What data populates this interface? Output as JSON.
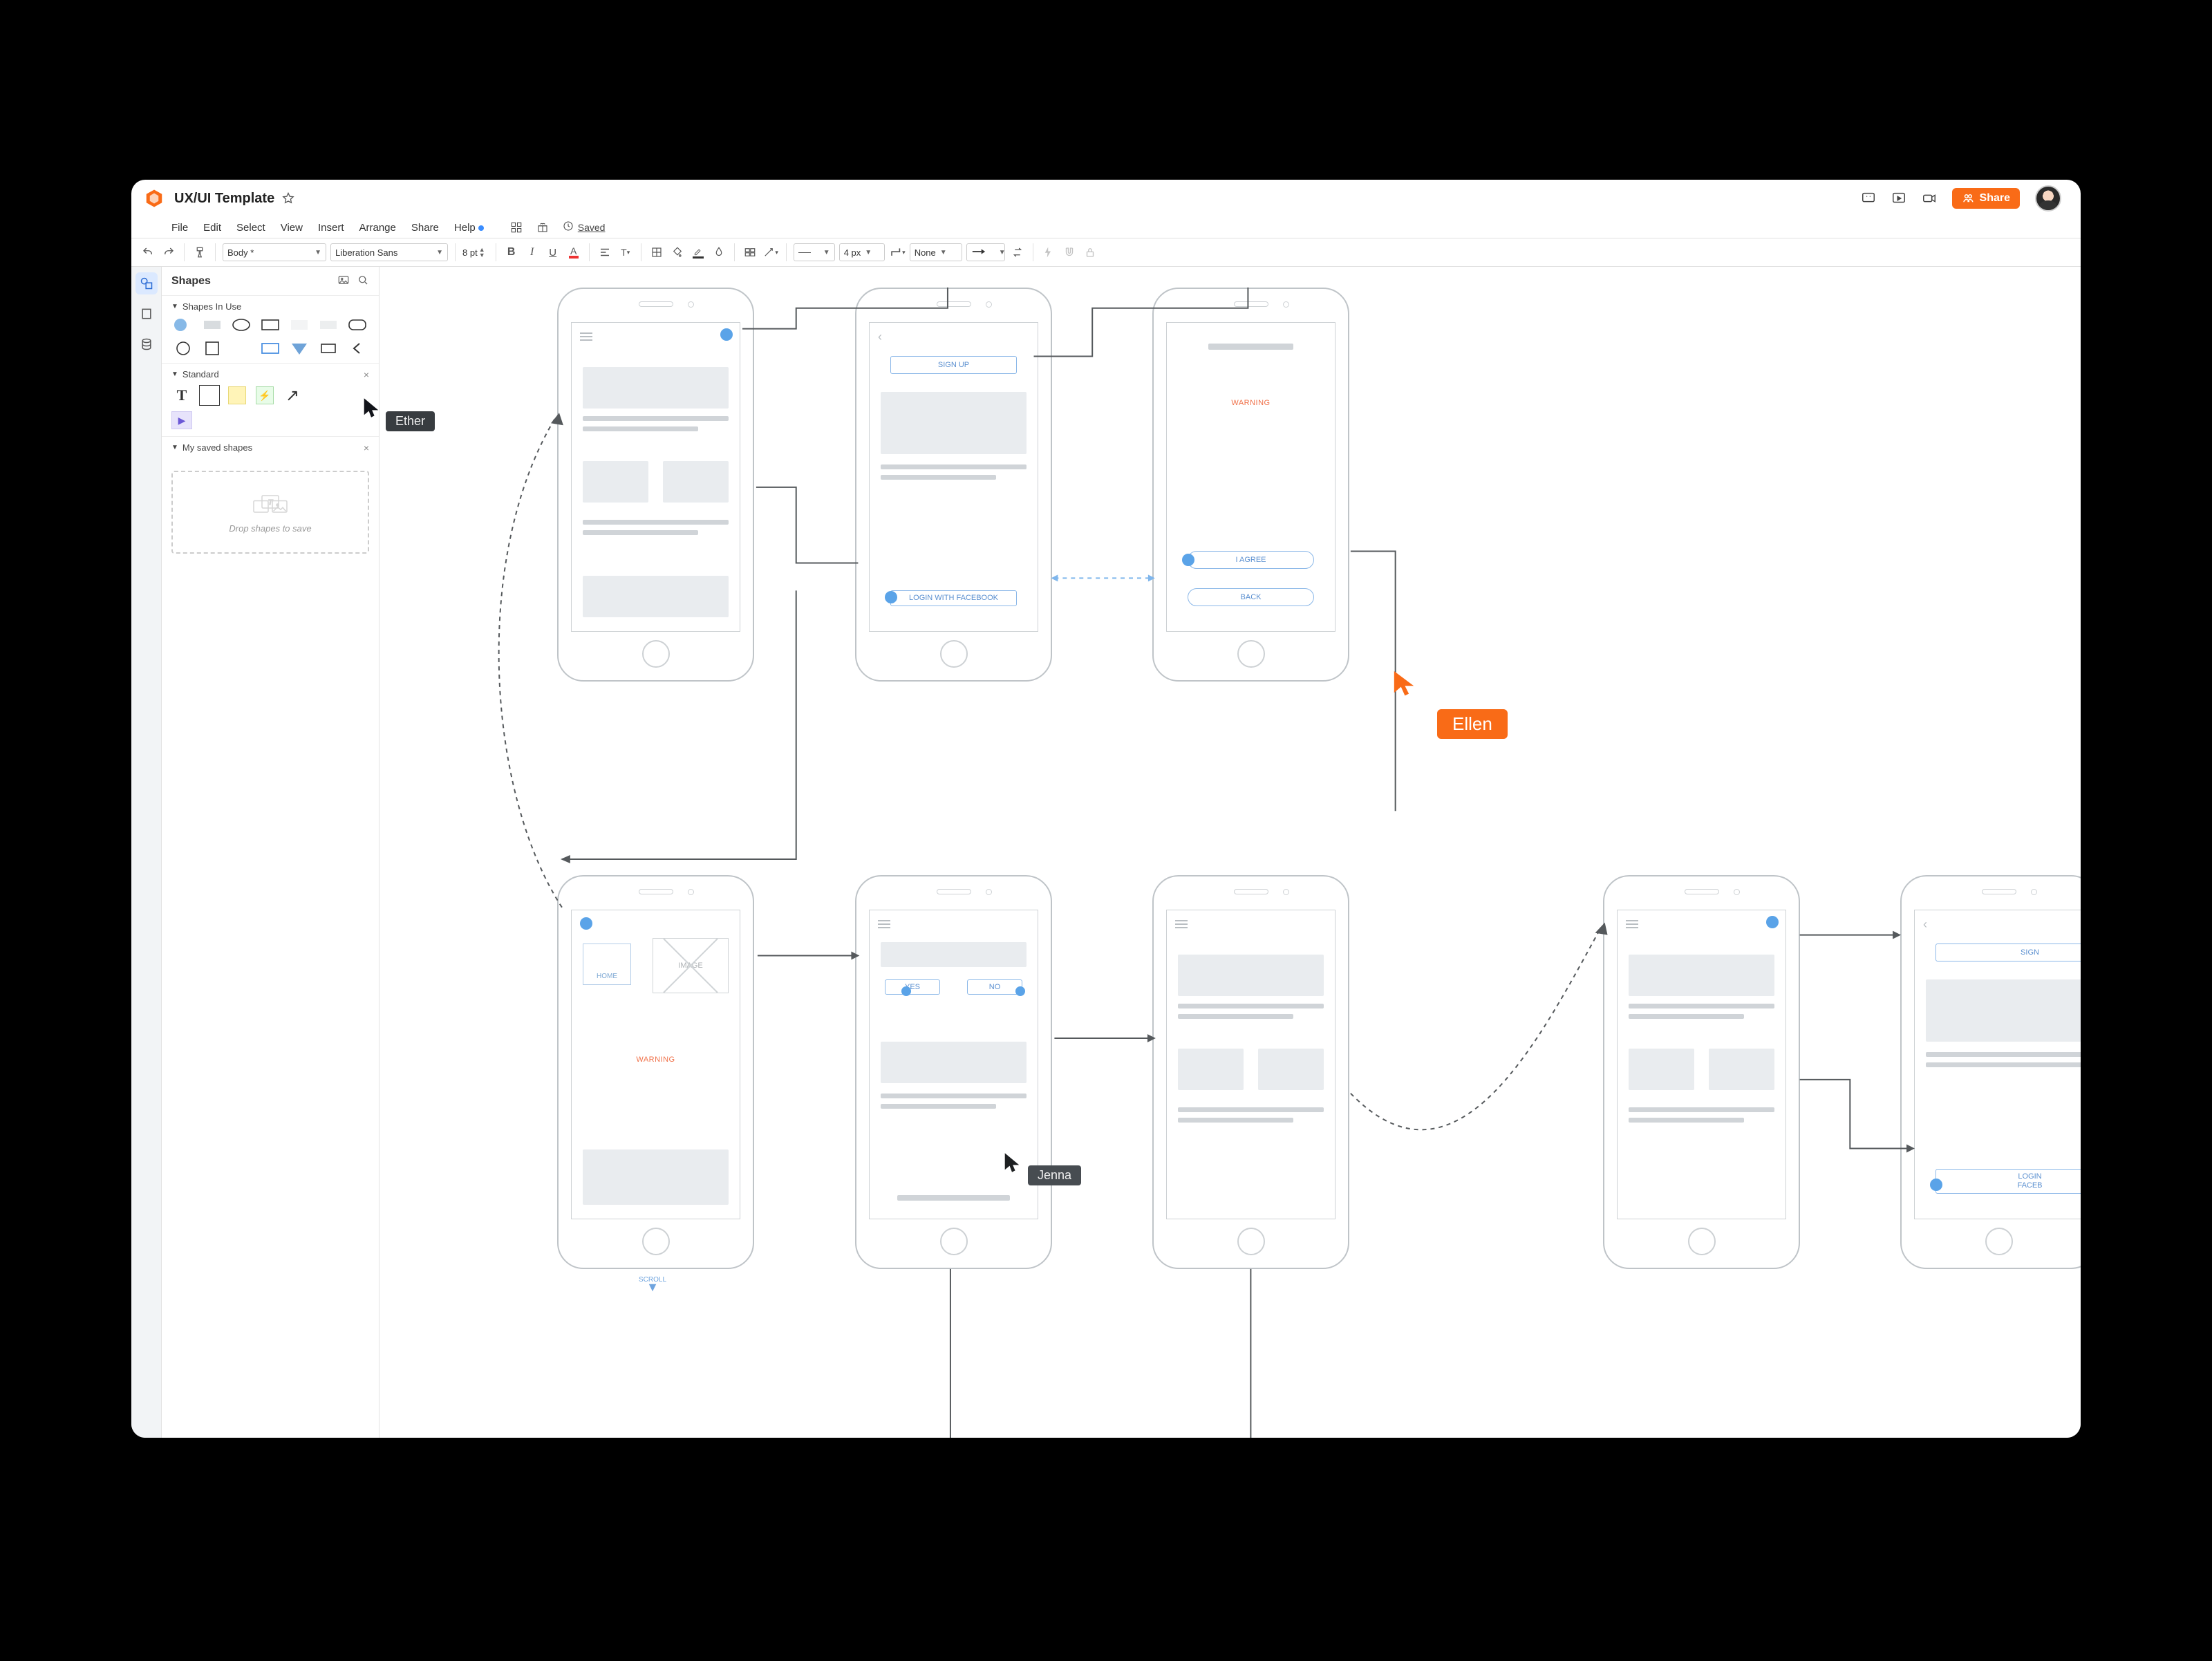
{
  "header": {
    "doc_title": "UX/UI Template",
    "share_label": "Share",
    "saved_label": "Saved"
  },
  "menu": {
    "file": "File",
    "edit": "Edit",
    "select": "Select",
    "view": "View",
    "insert": "Insert",
    "arrange": "Arrange",
    "share": "Share",
    "help": "Help"
  },
  "toolbar": {
    "style_select": "Body *",
    "font_select": "Liberation Sans",
    "font_size": "8 pt",
    "stroke_width": "4 px",
    "line_end": "None"
  },
  "sidebar": {
    "title": "Shapes",
    "section_in_use": "Shapes In Use",
    "section_standard": "Standard",
    "section_saved": "My saved shapes",
    "drop_hint": "Drop shapes to save"
  },
  "collaborators": {
    "ether": "Ether",
    "jenna": "Jenna",
    "ellen": "Ellen"
  },
  "wireframes": {
    "signup": "SIGN UP",
    "login_fb": "LOGIN WITH FACEBOOK",
    "login_fb_short": "LOGIN\nFACEB",
    "warning": "WARNING",
    "i_agree": "I AGREE",
    "back": "BACK",
    "home": "HOME",
    "image": "IMAGE",
    "yes": "YES",
    "no": "NO",
    "scroll": "SCROLL",
    "sign_short": "SIGN"
  }
}
